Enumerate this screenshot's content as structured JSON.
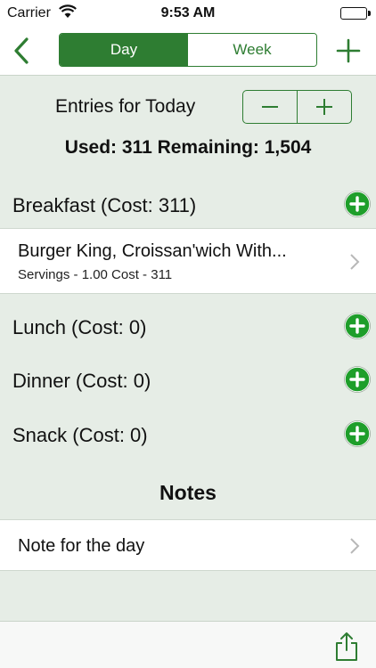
{
  "status": {
    "carrier": "Carrier",
    "time": "9:53 AM"
  },
  "nav": {
    "segments": [
      {
        "label": "Day",
        "active": true
      },
      {
        "label": "Week",
        "active": false
      }
    ]
  },
  "entries": {
    "title": "Entries for Today",
    "summary": "Used: 311 Remaining: 1,504"
  },
  "meals": {
    "breakfast": {
      "label": "Breakfast (Cost: 311)",
      "items": [
        {
          "name": "Burger King, Croissan'wich With...",
          "detail": "Servings - 1.00 Cost - 311"
        }
      ]
    },
    "lunch": {
      "label": "Lunch (Cost: 0)"
    },
    "dinner": {
      "label": "Dinner (Cost: 0)"
    },
    "snack": {
      "label": "Snack (Cost: 0)"
    }
  },
  "notes": {
    "title": "Notes",
    "item": "Note for the day"
  },
  "colors": {
    "accent": "#2e7d32",
    "add_button": "#1e9e2a",
    "background": "#e6ede6"
  }
}
